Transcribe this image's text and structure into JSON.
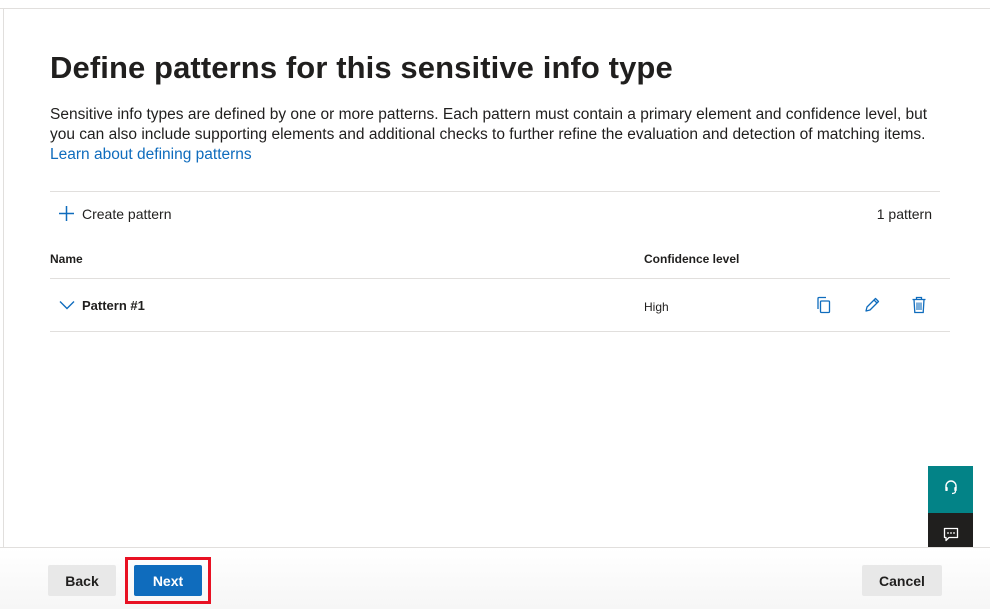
{
  "page": {
    "title": "Define patterns for this sensitive info type",
    "description": "Sensitive info types are defined by one or more patterns. Each pattern must contain a primary element and confidence level, but you can also include supporting elements and additional checks to further refine the evaluation and detection of matching items.",
    "learn_link": "Learn about defining patterns"
  },
  "toolbar": {
    "create_label": "Create pattern",
    "count_label": "1 pattern"
  },
  "table": {
    "headers": {
      "name": "Name",
      "confidence": "Confidence level"
    },
    "rows": [
      {
        "name": "Pattern #1",
        "confidence": "High"
      }
    ]
  },
  "icons": {
    "create": "add-icon",
    "expand": "chevron-down-icon",
    "copy": "copy-icon",
    "edit": "edit-icon",
    "delete": "delete-icon",
    "help": "headset-icon",
    "feedback": "feedback-icon"
  },
  "footer": {
    "back_label": "Back",
    "next_label": "Next",
    "cancel_label": "Cancel"
  },
  "colors": {
    "accent": "#0f6cbd",
    "help_bg": "#038387",
    "feedback_bg": "#201f1e",
    "highlight": "#e81123"
  }
}
